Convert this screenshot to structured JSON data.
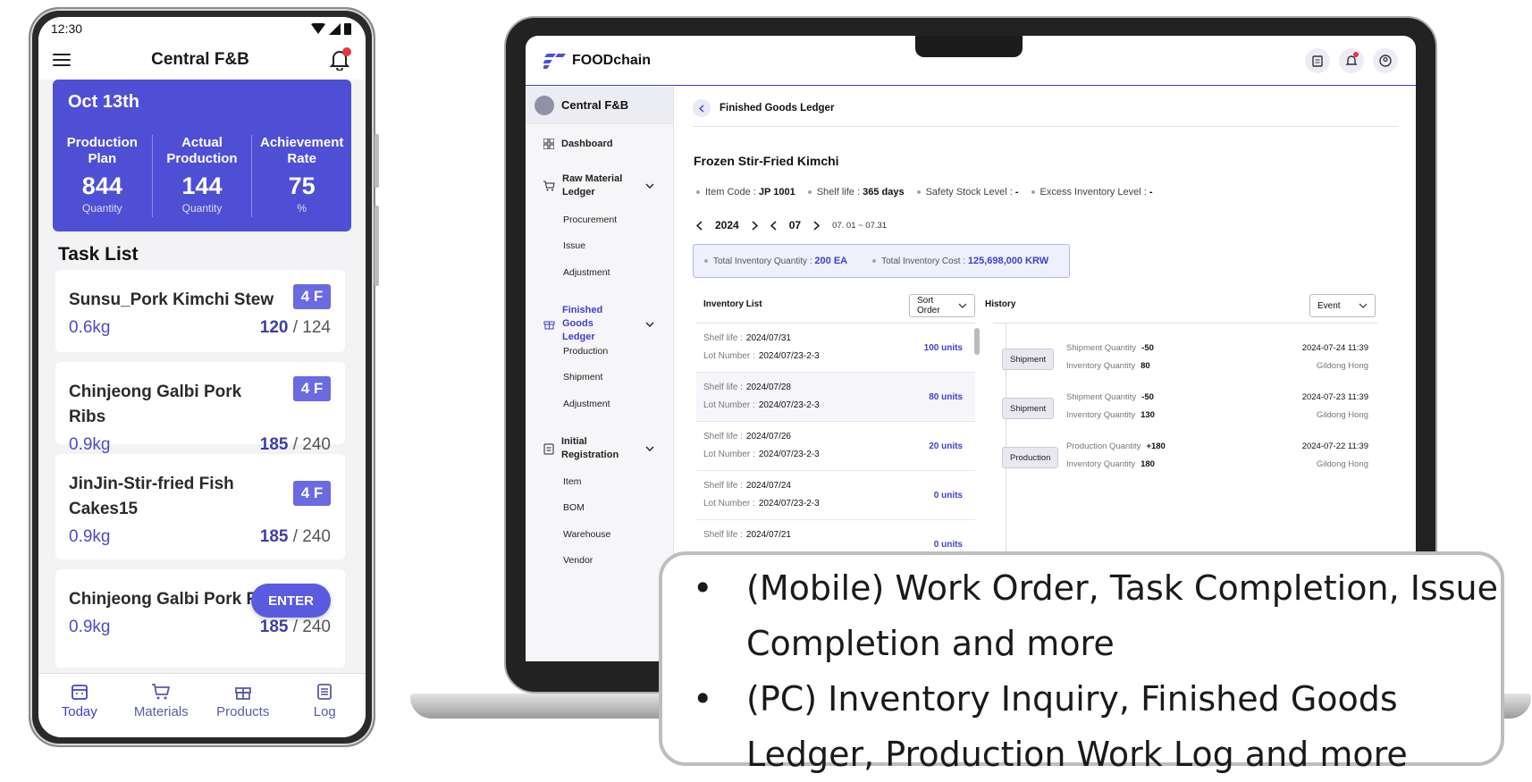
{
  "mobile": {
    "status": {
      "time": "12:30"
    },
    "appbar": {
      "title": "Central F&B"
    },
    "summary": {
      "date": "Oct 13th",
      "cols": [
        {
          "label": "Production Plan",
          "value": "844",
          "unit": "Quantity"
        },
        {
          "label": "Actual Production",
          "value": "144",
          "unit": "Quantity"
        },
        {
          "label": "Achievement Rate",
          "value": "75",
          "unit": "%"
        }
      ]
    },
    "task_list_title": "Task List",
    "tasks": [
      {
        "name": "Sunsu_Pork Kimchi Stew",
        "badge": "4 F",
        "weight": "0.6kg",
        "done": "120",
        "total": "/ 124"
      },
      {
        "name": "Chinjeong Galbi Pork Ribs",
        "badge": "4 F",
        "weight": "0.9kg",
        "done": "185",
        "total": "/ 240"
      },
      {
        "name": "JinJin-Stir-fried Fish Cakes15",
        "badge": "4 F",
        "weight": "0.9kg",
        "done": "185",
        "total": "/ 240"
      },
      {
        "name": "Chinjeong Galbi Pork Ri",
        "badge": "",
        "weight": "0.9kg",
        "done": "185",
        "total": "/ 240"
      }
    ],
    "enter_label": "ENTER",
    "nav": [
      {
        "label": "Today",
        "icon": "calendar-icon"
      },
      {
        "label": "Materials",
        "icon": "cart-icon"
      },
      {
        "label": "Products",
        "icon": "gift-icon"
      },
      {
        "label": "Log",
        "icon": "log-icon"
      }
    ]
  },
  "pc": {
    "logo": "FOODchain",
    "company": "Central F&B",
    "sidebar": {
      "dashboard": "Dashboard",
      "raw": "Raw Material Ledger",
      "raw_subs": [
        "Procurement",
        "Issue",
        "Adjustment"
      ],
      "finished": "Finished Goods Ledger",
      "finished_subs": [
        "Production",
        "Shipment",
        "Adjustment"
      ],
      "initial": "Initial Registration",
      "initial_subs": [
        "Item",
        "BOM",
        "Warehouse",
        "Vendor"
      ]
    },
    "breadcrumb": "Finished Goods Ledger",
    "item_title": "Frozen Stir-Fried Kimchi",
    "meta": {
      "item_code_label": "Item Code :",
      "item_code": "JP 1001",
      "shelf_label": "Shelf life :",
      "shelf": "365 days",
      "safety_label": "Safety Stock Level :",
      "safety": "-",
      "excess_label": "Excess Inventory Level :",
      "excess": "-"
    },
    "period": {
      "year": "2024",
      "month": "07",
      "range": "07. 01 ~ 07.31"
    },
    "totals": {
      "qty_label": "Total Inventory Quantity :",
      "qty": "200 EA",
      "cost_label": "Total Inventory Cost :",
      "cost": "125,698,000 KRW"
    },
    "inventory_title": "Inventory List",
    "sort_label": "Sort Order",
    "history_title": "History",
    "event_label": "Event",
    "inventory": [
      {
        "shelf": "2024/07/31",
        "lot": "2024/07/23-2-3",
        "units": "100 units"
      },
      {
        "shelf": "2024/07/28",
        "lot": "2024/07/23-2-3",
        "units": "80 units"
      },
      {
        "shelf": "2024/07/26",
        "lot": "2024/07/23-2-3",
        "units": "20 units"
      },
      {
        "shelf": "2024/07/24",
        "lot": "2024/07/23-2-3",
        "units": "0 units"
      },
      {
        "shelf": "2024/07/21",
        "lot": "",
        "units": "0 units"
      }
    ],
    "inv_labels": {
      "shelf": "Shelf life :",
      "lot": "Lot Number :"
    },
    "history": [
      {
        "tag": "Shipment",
        "l1": "Shipment Quantity",
        "v1": "-50",
        "l2": "Inventory Quantity",
        "v2": "80",
        "time": "2024-07-24 11:39",
        "who": "Gildong Hong"
      },
      {
        "tag": "Shipment",
        "l1": "Shipment Quantity",
        "v1": "-50",
        "l2": "Inventory Quantity",
        "v2": "130",
        "time": "2024-07-23 11:39",
        "who": "Gildong Hong"
      },
      {
        "tag": "Production",
        "l1": "Production Quantity",
        "v1": "+180",
        "l2": "Inventory Quantity",
        "v2": "180",
        "time": "2024-07-22 11:39",
        "who": "Gildong Hong"
      }
    ]
  },
  "callout": [
    "(Mobile) Work Order, Task Completion, Issue Completion and more",
    "(PC) Inventory Inquiry, Finished Goods Ledger, Production Work Log and more"
  ],
  "colors": {
    "accent": "#4f4fd6",
    "alert": "#e5383b"
  }
}
